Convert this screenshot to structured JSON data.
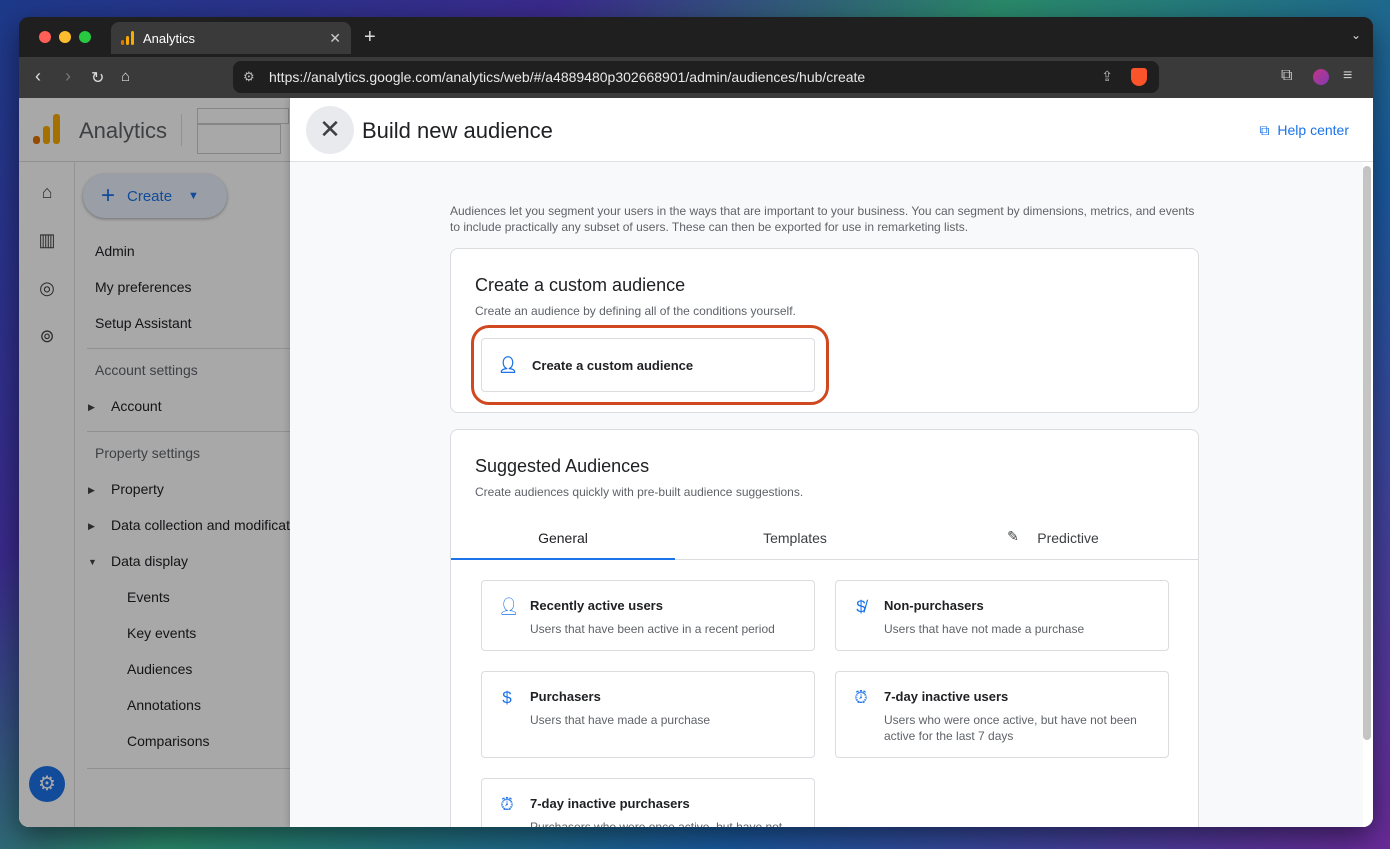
{
  "browser": {
    "tab_title": "Analytics",
    "tab_close": "✕",
    "new_tab": "+",
    "url": "https://analytics.google.com/analytics/web/#/a4889480p302668901/admin/audiences/hub/create"
  },
  "ga": {
    "title": "Analytics",
    "create_label": "Create",
    "nav": {
      "admin": "Admin",
      "my_preferences": "My preferences",
      "setup_assistant": "Setup Assistant",
      "account_settings": "Account settings",
      "account": "Account",
      "property_settings": "Property settings",
      "property": "Property",
      "data_collection": "Data collection and modifications",
      "data_display": "Data display",
      "events": "Events",
      "key_events": "Key events",
      "audiences": "Audiences",
      "annotations": "Annotations",
      "comparisons": "Comparisons"
    }
  },
  "panel": {
    "title": "Build new audience",
    "help_center": "Help center",
    "intro": "Audiences let you segment your users in the ways that are important to your business. You can segment by dimensions, metrics, and events to include practically any subset of users. These can then be exported for use in remarketing lists.",
    "custom": {
      "title": "Create a custom audience",
      "subtitle": "Create an audience by defining all of the conditions yourself.",
      "button": "Create a custom audience"
    },
    "suggested": {
      "title": "Suggested Audiences",
      "subtitle": "Create audiences quickly with pre-built audience suggestions.",
      "tabs": [
        "General",
        "Templates",
        "Predictive"
      ],
      "items": [
        {
          "title": "Recently active users",
          "desc": "Users that have been active in a recent period",
          "icon": "person-icon"
        },
        {
          "title": "Non-purchasers",
          "desc": "Users that have not made a purchase",
          "icon": "money-off-icon"
        },
        {
          "title": "Purchasers",
          "desc": "Users that have made a purchase",
          "icon": "dollar-icon"
        },
        {
          "title": "7-day inactive users",
          "desc": "Users who were once active, but have not been active for the last 7 days",
          "icon": "alarm-off-icon"
        },
        {
          "title": "7-day inactive purchasers",
          "desc": "Purchasers who were once active, but have not",
          "icon": "alarm-off-icon"
        }
      ]
    }
  },
  "colors": {
    "accent": "#1a73e8",
    "highlight": "#d0481f",
    "ga_logo": "#f9ab00"
  }
}
